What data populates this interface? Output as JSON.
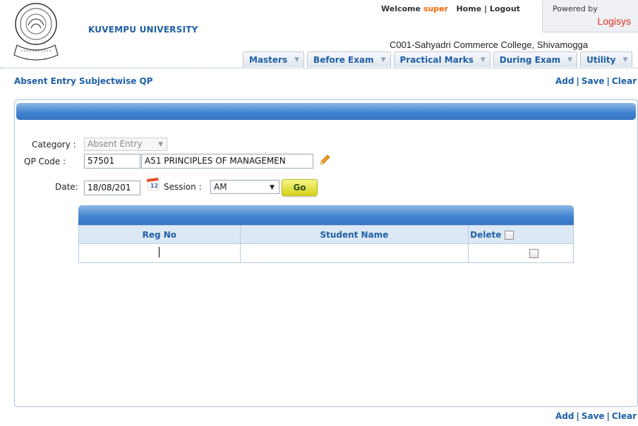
{
  "header": {
    "university": "KUVEMPU UNIVERSITY",
    "welcome_prefix": "Welcome",
    "user": "super",
    "home": "Home",
    "logout": "Logout",
    "powered_by": "Powered by",
    "vendor": "Logisys",
    "college": "C001-Sahyadri Commerce College, Shivamogga"
  },
  "menu": [
    "Masters",
    "Before Exam",
    "Practical Marks",
    "During Exam",
    "Utility"
  ],
  "page": {
    "title": "Absent Entry Subjectwise QP",
    "actions": {
      "add": "Add",
      "save": "Save",
      "clear": "Clear"
    }
  },
  "form": {
    "category_label": "Category :",
    "category_value": "Absent Entry",
    "qp_label": "QP Code :",
    "qp_code": "57501",
    "qp_name": "A51 PRINCIPLES OF MANAGEMEN",
    "date_label": "Date:",
    "date_value": "18/08/201",
    "calendar_badge": "12",
    "session_label": "Session :",
    "session_value": "AM",
    "go_label": "Go"
  },
  "grid": {
    "columns": [
      "Reg No",
      "Student Name",
      "Delete"
    ]
  },
  "icons": {
    "logo": "university-emblem-icon",
    "pencil": "pencil-icon",
    "calendar": "calendar-icon"
  },
  "colors": {
    "brand_blue": "#1f5fa8",
    "header_gradient": "#3f82cf",
    "accent_orange": "#ff6600",
    "vendor_red": "#e0301e",
    "go_yellow": "#e5e23a"
  }
}
